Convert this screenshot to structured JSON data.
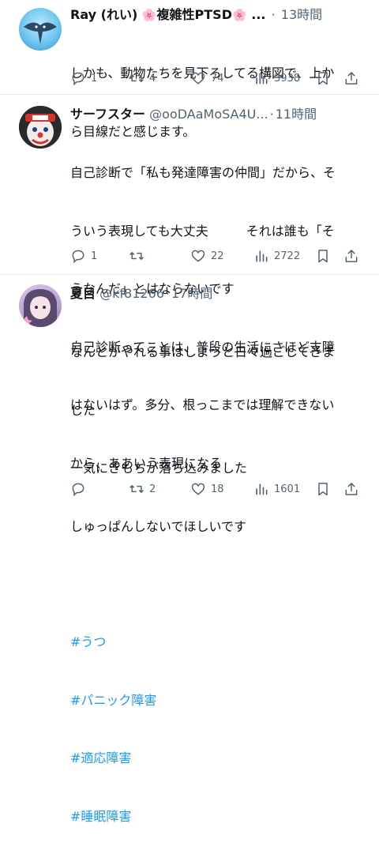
{
  "posts": [
    {
      "name_prefix": "Ray (れい)",
      "name_flower_left": "🌸",
      "name_middle": "複雑性PTSD",
      "name_flower_right": "🌸",
      "ellipsis": "...",
      "dot": "·",
      "time": "13時間",
      "lines": [
        "しかも、動物たちを見下ろしてる構図で、上か",
        "ら目線だと感じます。"
      ],
      "stats": {
        "replies": "1",
        "reposts": "4",
        "likes": "74",
        "views": "3938"
      },
      "avatar_icon": "manta-ray-avatar"
    },
    {
      "name": "サーフスター",
      "handle": "@ooDAaMoSA4U...",
      "dot": "·",
      "time": "11時間",
      "lines": [
        "自己診断で「私も発達障害の仲間」だから、そ",
        "ういう表現しても大丈夫　　　それは誰も「そ",
        "うなんだ」とはならないです",
        "自己診断ってことは、普段の生活にさほど支障",
        "はないはず。多分、根っこまでは理解できない",
        "から、ああいう表現になる"
      ],
      "stats": {
        "replies": "1",
        "reposts": "",
        "likes": "22",
        "views": "2722"
      },
      "avatar_icon": "clown-avatar"
    },
    {
      "name": "夏目",
      "handle": "@kf81266",
      "dot": "·",
      "time": "17時間",
      "lines": [
        "なんとかやれる事はしようと日々過ごしてきま",
        "した",
        "一気にきもちが落ち込みました",
        "しゅっぱんしないでほしいです"
      ],
      "hashtags": [
        "#うつ",
        "#パニック障害",
        "#適応障害",
        "#睡眠障害"
      ],
      "stats": {
        "replies": "",
        "reposts": "2",
        "likes": "18",
        "views": "1601"
      },
      "avatar_icon": "anime-girl-avatar"
    }
  ],
  "colors": {
    "text": "#0f1419",
    "muted": "#536471",
    "link": "#1d9bf0",
    "divider": "#e6ecf0"
  }
}
